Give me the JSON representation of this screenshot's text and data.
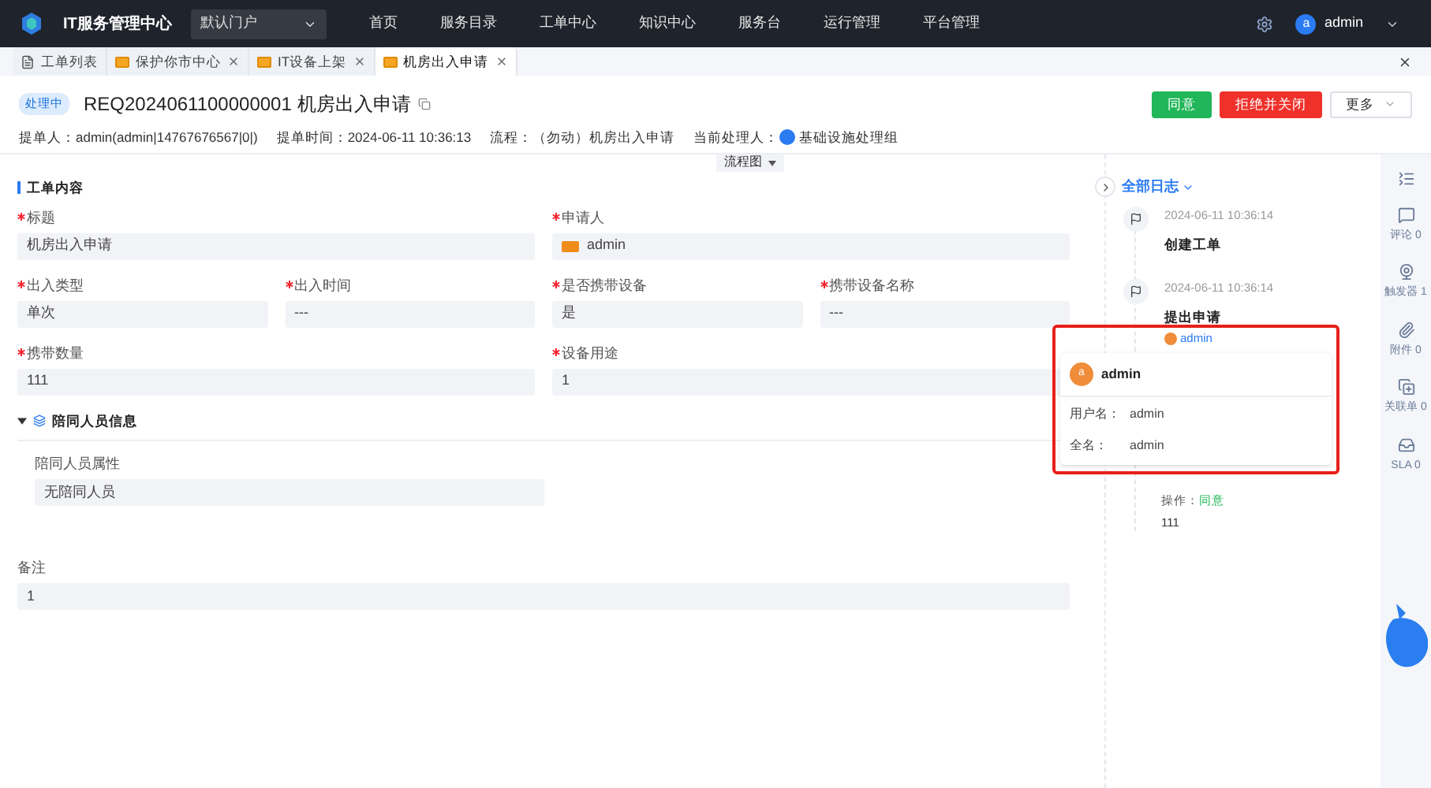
{
  "topnav": {
    "app_title": "IT服务管理中心",
    "portal": "默认门户",
    "menu": [
      "首页",
      "服务目录",
      "工单中心",
      "知识中心",
      "服务台",
      "运行管理",
      "平台管理"
    ],
    "user_initial": "a",
    "user_name": "admin"
  },
  "tabs": [
    {
      "label": "工单列表",
      "kind": "list",
      "selected": false
    },
    {
      "label": "保护你市中心",
      "kind": "ticket",
      "selected": false
    },
    {
      "label": "IT设备上架",
      "kind": "ticket",
      "selected": false
    },
    {
      "label": "机房出入申请",
      "kind": "ticket",
      "selected": true
    }
  ],
  "header": {
    "status": "处理中",
    "ticket_id": "REQ2024061100000001",
    "title": "机房出入申请",
    "buttons": [
      {
        "label": "同意",
        "kind": "approve"
      },
      {
        "label": "拒绝并关闭",
        "kind": "reject"
      },
      {
        "label": "更多",
        "kind": "more"
      }
    ],
    "meta": [
      {
        "label": "提单人：",
        "value": "admin(admin|14767676567|0|)"
      },
      {
        "label": "提单时间：",
        "value": "2024-06-11 10:36:13"
      },
      {
        "label": "流程：",
        "value": "（勿动）机房出入申请"
      },
      {
        "label": "当前处理人：",
        "value": "基础设施处理组",
        "kind": "group"
      }
    ]
  },
  "flow_button": "流程图",
  "content": {
    "title": "工单内容",
    "rows": [
      [
        {
          "label": "标题",
          "value": "机房出入申请",
          "required": true
        },
        {
          "label": "申请人",
          "value": "admin",
          "required": true,
          "kind": "user"
        }
      ],
      [
        {
          "label": "出入类型",
          "value": "单次",
          "required": true
        },
        {
          "label": "出入时间",
          "value": "---",
          "required": true
        },
        {
          "label": "是否携带设备",
          "value": "是",
          "required": true
        },
        {
          "label": "携带设备名称",
          "value": "---",
          "required": true
        }
      ],
      [
        {
          "label": "携带数量",
          "value": "111",
          "required": true
        },
        {
          "label": "设备用途",
          "value": "1",
          "required": true
        }
      ]
    ],
    "group": {
      "title": "陪同人员信息",
      "expanded": true,
      "fields": [
        {
          "label": "陪同人员属性",
          "value": "无陪同人员",
          "required": false
        }
      ]
    },
    "remark": {
      "label": "备注",
      "value": "1",
      "required": false
    }
  },
  "log": {
    "title": "全部日志",
    "entries": [
      {
        "time": "2024-06-11 10:36:14",
        "title": "创建工单"
      },
      {
        "time": "2024-06-11 10:36:14",
        "title": "提出申请",
        "user": "admin"
      }
    ],
    "action_label": "操作：",
    "action": "同意",
    "note": "111"
  },
  "popup": {
    "initial": "a",
    "name": "admin",
    "rows": [
      {
        "label": "用户名：",
        "value": "admin"
      },
      {
        "label": "全名：",
        "value": "admin"
      }
    ]
  },
  "rail": [
    {
      "kind": "collapse"
    },
    {
      "kind": "comment",
      "label": "评论 0"
    },
    {
      "kind": "trigger",
      "label": "触发器 1"
    },
    {
      "kind": "attachment",
      "label": "附件 0"
    },
    {
      "kind": "link",
      "label": "关联单 0"
    },
    {
      "kind": "sla",
      "label": "SLA 0"
    }
  ]
}
